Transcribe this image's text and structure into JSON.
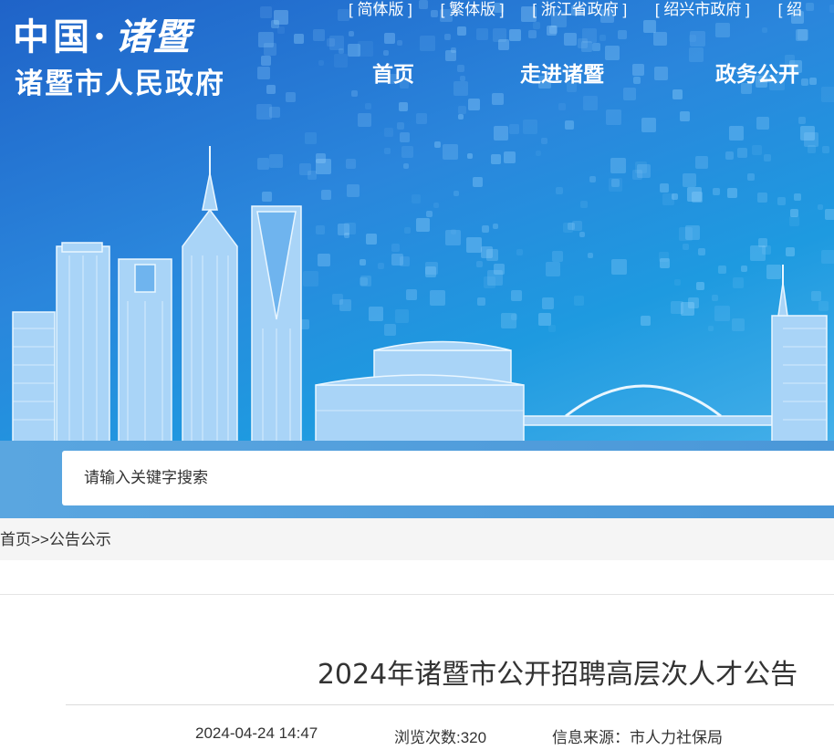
{
  "header": {
    "logo_main": "中国·",
    "logo_calligraphy": "诸暨",
    "logo_sub": "诸暨市人民政府",
    "top_links": [
      "[ 简体版 ]",
      "[ 繁体版 ]",
      "[ 浙江省政府 ]",
      "[ 绍兴市政府 ]",
      "[ 绍"
    ]
  },
  "nav": {
    "items": [
      {
        "label": "首页"
      },
      {
        "label": "走进诸暨"
      },
      {
        "label": "政务公开"
      }
    ]
  },
  "search": {
    "placeholder": "请输入关键字搜索"
  },
  "breadcrumb": {
    "home": "首页",
    "separator": ">>",
    "current": "公告公示"
  },
  "article": {
    "title": "2024年诸暨市公开招聘高层次人才公告",
    "date": "2024-04-24 14:47",
    "views": "浏览次数:320",
    "source": "信息来源：市人力社保局"
  },
  "colors": {
    "hero_dark": "#1f63c8",
    "hero_light": "#52b7ec",
    "building": "#bde0fb"
  }
}
